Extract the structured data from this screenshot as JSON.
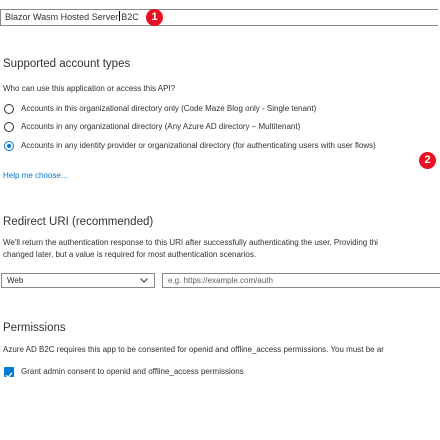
{
  "app_name": {
    "value_before_cursor": "Blazor Wasm Hosted Server",
    "value_after_cursor": "B2C"
  },
  "callouts": [
    "1",
    "2"
  ],
  "account_types": {
    "heading": "Supported account types",
    "question": "Who can use this application or access this API?",
    "options": [
      "Accounts in this organizational directory only (Code Maze Blog only - Single tenant)",
      "Accounts in any organizational directory (Any Azure AD directory – Multitenant)",
      "Accounts in any identity provider or organizational directory (for authenticating users with user flows)"
    ],
    "selected_index": 2,
    "help_link": "Help me choose..."
  },
  "redirect": {
    "heading": "Redirect URI (recommended)",
    "description_line1": "We'll return the authentication response to this URI after successfully authenticating the user. Providing thi",
    "description_line2": "changed later, but a value is required for most authentication scenarios.",
    "platform_value": "Web",
    "uri_placeholder": "e.g. https://example.com/auth"
  },
  "permissions": {
    "heading": "Permissions",
    "description": "Azure AD B2C requires this app to be consented for openid and offline_access permissions. You must be ar",
    "checkbox_label": "Grant admin consent to openid and offline_access permissions",
    "checkbox_checked": true
  },
  "colors": {
    "accent": "#0078d4",
    "callout": "#e81123"
  }
}
